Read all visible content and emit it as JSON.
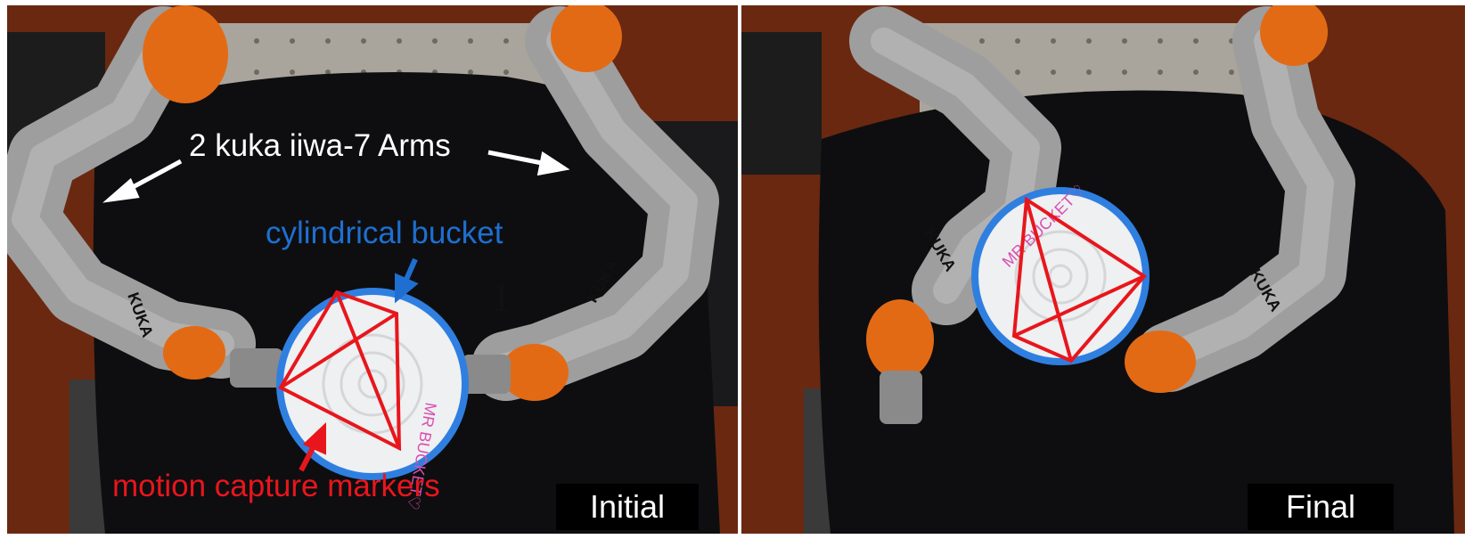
{
  "left_panel": {
    "state_label": "Initial",
    "annotations": {
      "arms": "2 kuka iiwa-7 Arms",
      "bucket": "cylindrical bucket",
      "markers": "motion capture markers",
      "stray_digit": "1"
    },
    "arm_brand_text": "KUKA",
    "bucket_text": "MR BUCKET♡"
  },
  "right_panel": {
    "state_label": "Final",
    "arm_brand_text": "KUKA",
    "bucket_text": "MR BUCKET♡"
  },
  "colors": {
    "marker_lines": "#e8161c",
    "bucket_annotation": "#1e6fd0",
    "arms_annotation": "#ffffff",
    "robot_gray": "#9e9e9e",
    "robot_orange": "#e36a14",
    "tape_blue": "#2f7fe0",
    "cloth": "#0e0e10",
    "floor": "#6a2a12"
  }
}
